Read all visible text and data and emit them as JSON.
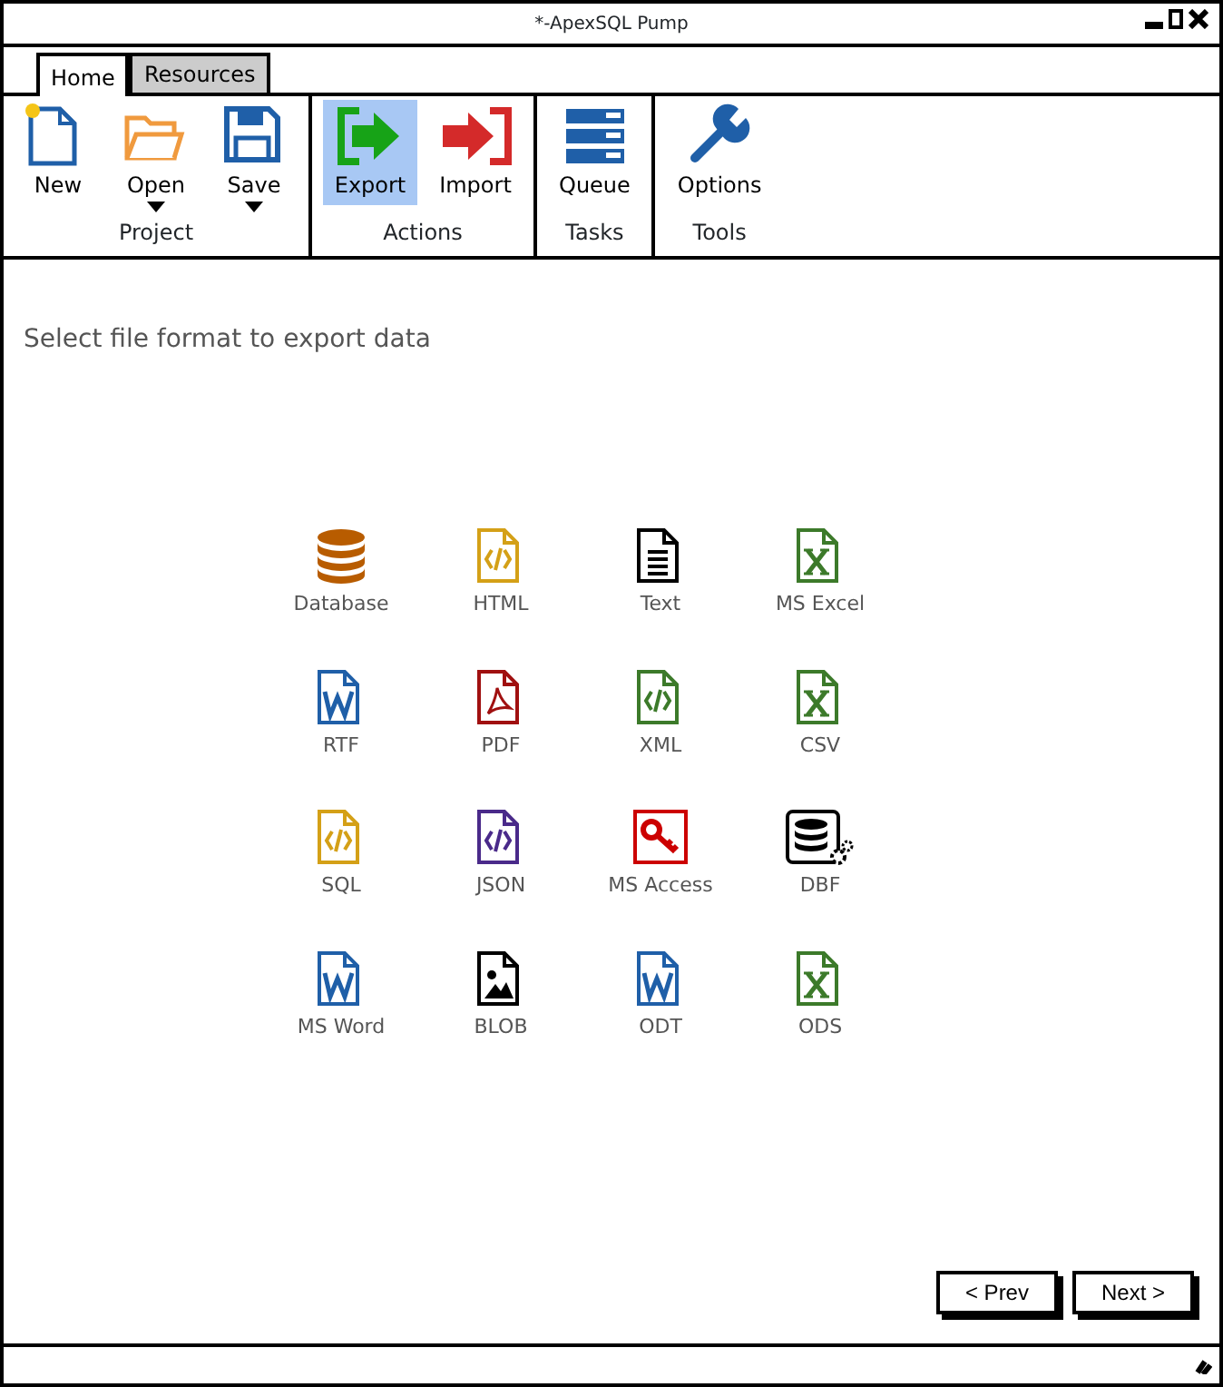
{
  "window": {
    "title": "*-ApexSQL Pump"
  },
  "tabs": [
    {
      "label": "Home",
      "selected": true
    },
    {
      "label": "Resources",
      "selected": false
    }
  ],
  "ribbon": {
    "groups": [
      {
        "label": "Project",
        "buttons": [
          {
            "label": "New",
            "kind": "new",
            "selected": false,
            "dropdown": false
          },
          {
            "label": "Open",
            "kind": "open",
            "selected": false,
            "dropdown": true
          },
          {
            "label": "Save",
            "kind": "save",
            "selected": false,
            "dropdown": true
          }
        ]
      },
      {
        "label": "Actions",
        "buttons": [
          {
            "label": "Export",
            "kind": "export",
            "selected": true,
            "dropdown": false
          },
          {
            "label": "Import",
            "kind": "import",
            "selected": false,
            "dropdown": false
          }
        ]
      },
      {
        "label": "Tasks",
        "buttons": [
          {
            "label": "Queue",
            "kind": "queue",
            "selected": false,
            "dropdown": false
          }
        ]
      },
      {
        "label": "Tools",
        "buttons": [
          {
            "label": "Options",
            "kind": "options",
            "selected": false,
            "dropdown": false
          }
        ]
      }
    ]
  },
  "heading": "Select file format to export data",
  "formats": [
    {
      "label": "Database",
      "kind": "database",
      "color": "#b85c00"
    },
    {
      "label": "HTML",
      "kind": "code",
      "color": "#d4a017"
    },
    {
      "label": "Text",
      "kind": "text",
      "color": "#000000"
    },
    {
      "label": "MS Excel",
      "kind": "sheet",
      "color": "#3c7a2a"
    },
    {
      "label": "RTF",
      "kind": "word",
      "color": "#1f5fa8"
    },
    {
      "label": "PDF",
      "kind": "pdf",
      "color": "#a01010"
    },
    {
      "label": "XML",
      "kind": "code",
      "color": "#3c7a2a"
    },
    {
      "label": "CSV",
      "kind": "sheet",
      "color": "#3c7a2a"
    },
    {
      "label": "SQL",
      "kind": "code",
      "color": "#d4a017"
    },
    {
      "label": "JSON",
      "kind": "code",
      "color": "#4a2a8a"
    },
    {
      "label": "MS Access",
      "kind": "key",
      "color": "#cc0000"
    },
    {
      "label": "DBF",
      "kind": "dbgear",
      "color": "#000000"
    },
    {
      "label": "MS Word",
      "kind": "word",
      "color": "#1f5fa8"
    },
    {
      "label": "BLOB",
      "kind": "image",
      "color": "#000000"
    },
    {
      "label": "ODT",
      "kind": "word",
      "color": "#1f5fa8"
    },
    {
      "label": "ODS",
      "kind": "sheet",
      "color": "#3c7a2a"
    }
  ],
  "buttons": [
    {
      "label": "< Prev"
    },
    {
      "label": "Next >"
    }
  ]
}
